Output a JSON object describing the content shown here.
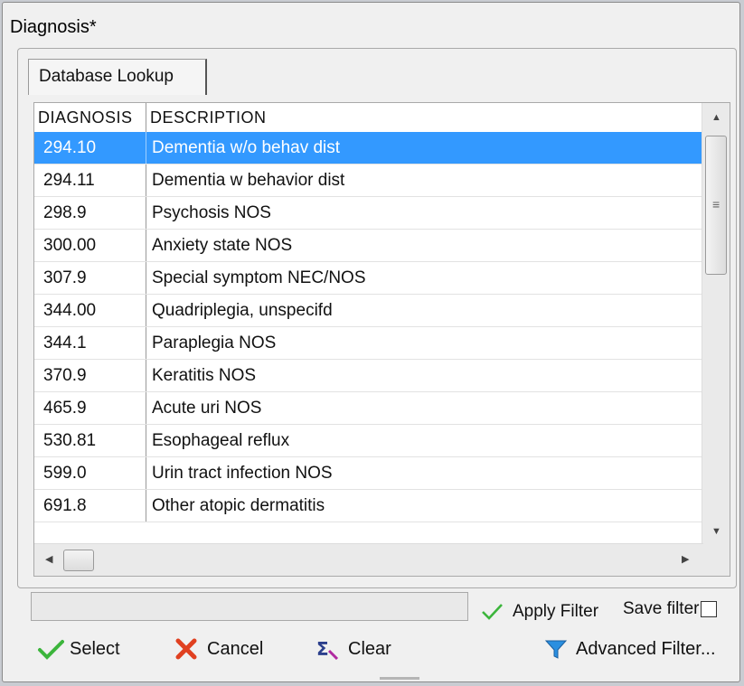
{
  "window": {
    "title": "Diagnosis*"
  },
  "tabs": [
    {
      "label": "Database Lookup"
    }
  ],
  "grid": {
    "columns": [
      "DIAGNOSIS",
      "DESCRIPTION"
    ],
    "rows": [
      {
        "code": "294.10",
        "description": "Dementia w/o behav dist",
        "selected": true
      },
      {
        "code": "294.11",
        "description": "Dementia w behavior dist"
      },
      {
        "code": "298.9",
        "description": "Psychosis NOS"
      },
      {
        "code": "300.00",
        "description": "Anxiety state NOS"
      },
      {
        "code": "307.9",
        "description": "Special symptom NEC/NOS"
      },
      {
        "code": "344.00",
        "description": "Quadriplegia, unspecifd"
      },
      {
        "code": "344.1",
        "description": "Paraplegia NOS"
      },
      {
        "code": "370.9",
        "description": "Keratitis NOS"
      },
      {
        "code": "465.9",
        "description": "Acute uri NOS"
      },
      {
        "code": "530.81",
        "description": "Esophageal reflux"
      },
      {
        "code": "599.0",
        "description": "Urin tract infection NOS"
      },
      {
        "code": "691.8",
        "description": "Other atopic dermatitis"
      }
    ]
  },
  "filter": {
    "value": "",
    "apply_label": "Apply Filter",
    "save_label": "Save filter",
    "save_checked": false
  },
  "buttons": {
    "select": "Select",
    "cancel": "Cancel",
    "clear": "Clear",
    "advanced": "Advanced Filter..."
  },
  "icons": {
    "apply": "check-icon",
    "select": "check-icon",
    "cancel": "x-icon",
    "clear": "sigma-icon",
    "advanced": "funnel-icon"
  },
  "colors": {
    "selection": "#3399ff",
    "check": "#3cb53c",
    "cancel": "#e04020",
    "funnel": "#2a8fe0"
  }
}
